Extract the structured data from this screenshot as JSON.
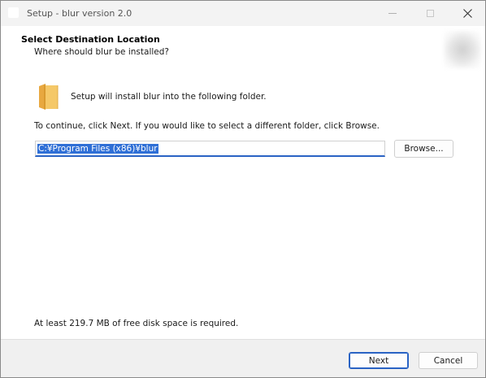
{
  "window": {
    "title": "Setup - blur version 2.0"
  },
  "header": {
    "title": "Select Destination Location",
    "subtitle": "Where should blur be installed?"
  },
  "main": {
    "install_text": "Setup will install blur into the following folder.",
    "continue_text": "To continue, click Next. If you would like to select a different folder, click Browse.",
    "path_value": "C:¥Program Files (x86)¥blur",
    "browse_label": "Browse...",
    "diskspace_text": "At least 219.7 MB of free disk space is required."
  },
  "footer": {
    "next_label": "Next",
    "cancel_label": "Cancel"
  },
  "icons": {
    "app": "app-icon",
    "folder": "folder-icon",
    "minimize": "minimize-icon",
    "maximize": "maximize-icon",
    "close": "close-icon"
  },
  "colors": {
    "accent": "#2a63c4",
    "selection": "#2f6fd6",
    "folder": "#f0c060"
  }
}
